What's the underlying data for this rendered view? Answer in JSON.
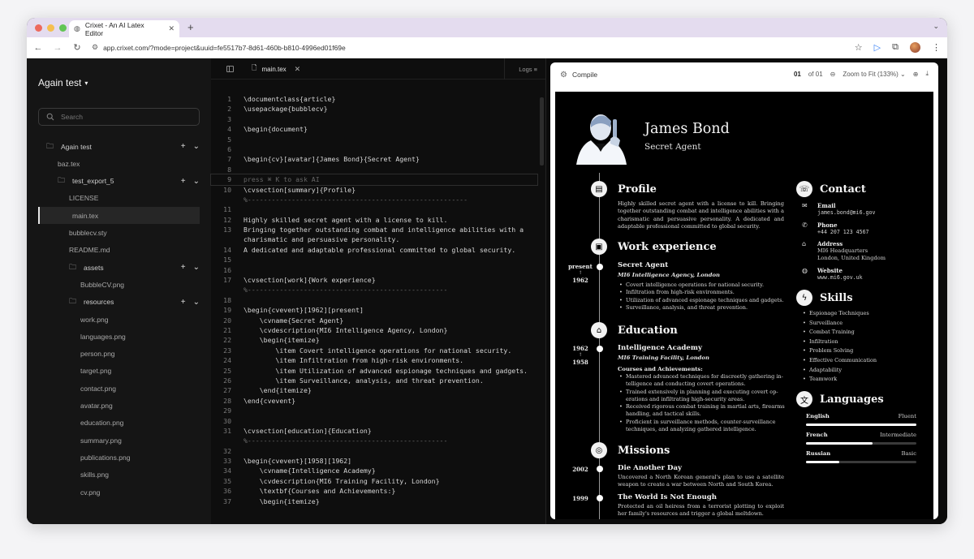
{
  "browser": {
    "tab_title": "Crixet - An AI Latex Editor",
    "url": "app.crixet.com/?mode=project&uuid=fe5517b7-8d61-460b-b810-4996ed01f69e",
    "traffic_colors": [
      "#ed6a5e",
      "#f5bf4f",
      "#61c554"
    ]
  },
  "sidebar": {
    "project_title": "Again test",
    "search_placeholder": "Search",
    "tree": [
      {
        "label": "Again test",
        "kind": "folder",
        "indent": 0,
        "actions": true
      },
      {
        "label": "baz.tex",
        "kind": "file",
        "indent": 1
      },
      {
        "label": "test_export_5",
        "kind": "folder",
        "indent": 1,
        "actions": true
      },
      {
        "label": "LICENSE",
        "kind": "file",
        "indent": 2
      },
      {
        "label": "main.tex",
        "kind": "file",
        "indent": 2,
        "active": true
      },
      {
        "label": "bubblecv.sty",
        "kind": "file",
        "indent": 2
      },
      {
        "label": "README.md",
        "kind": "file",
        "indent": 2
      },
      {
        "label": "assets",
        "kind": "folder",
        "indent": 2,
        "actions": true
      },
      {
        "label": "BubbleCV.png",
        "kind": "file",
        "indent": 3
      },
      {
        "label": "resources",
        "kind": "folder",
        "indent": 2,
        "actions": true
      },
      {
        "label": "work.png",
        "kind": "file",
        "indent": 3
      },
      {
        "label": "languages.png",
        "kind": "file",
        "indent": 3
      },
      {
        "label": "person.png",
        "kind": "file",
        "indent": 3
      },
      {
        "label": "target.png",
        "kind": "file",
        "indent": 3
      },
      {
        "label": "contact.png",
        "kind": "file",
        "indent": 3
      },
      {
        "label": "avatar.png",
        "kind": "file",
        "indent": 3
      },
      {
        "label": "education.png",
        "kind": "file",
        "indent": 3
      },
      {
        "label": "summary.png",
        "kind": "file",
        "indent": 3
      },
      {
        "label": "publications.png",
        "kind": "file",
        "indent": 3
      },
      {
        "label": "skills.png",
        "kind": "file",
        "indent": 3
      },
      {
        "label": "cv.png",
        "kind": "file",
        "indent": 3
      }
    ]
  },
  "editor": {
    "tab_label": "main.tex",
    "logs_label": "Logs",
    "lines": [
      {
        "n": "1",
        "t": "\\documentclass{article}"
      },
      {
        "n": "2",
        "t": "\\usepackage{bubblecv}"
      },
      {
        "n": "3",
        "t": ""
      },
      {
        "n": "4",
        "t": "\\begin{document}"
      },
      {
        "n": "5",
        "t": ""
      },
      {
        "n": "6",
        "t": ""
      },
      {
        "n": "7",
        "t": "\\begin{cv}[avatar]{James Bond}{Secret Agent}"
      },
      {
        "n": "8",
        "t": ""
      },
      {
        "n": "9",
        "t": "press ⌘ K to ask AI",
        "cur": true
      },
      {
        "n": "10",
        "t": "\\cvsection[summary]{Profile}"
      },
      {
        "n": "",
        "t": "%-------------------------------------------------------",
        "c": true
      },
      {
        "n": "11",
        "t": ""
      },
      {
        "n": "12",
        "t": "Highly skilled secret agent with a license to kill."
      },
      {
        "n": "13",
        "t": "Bringing together outstanding combat and intelligence abilities with a"
      },
      {
        "n": "",
        "t": "charismatic and persuasive personality."
      },
      {
        "n": "14",
        "t": "A dedicated and adaptable professional committed to global security."
      },
      {
        "n": "15",
        "t": ""
      },
      {
        "n": "16",
        "t": ""
      },
      {
        "n": "17",
        "t": "\\cvsection[work]{Work experience}"
      },
      {
        "n": "",
        "t": "%--------------------------------------------------",
        "c": true
      },
      {
        "n": "18",
        "t": ""
      },
      {
        "n": "19",
        "t": "\\begin{cvevent}[1962][present]"
      },
      {
        "n": "20",
        "t": "    \\cvname{Secret Agent}"
      },
      {
        "n": "21",
        "t": "    \\cvdescription{MI6 Intelligence Agency, London}"
      },
      {
        "n": "22",
        "t": "    \\begin{itemize}"
      },
      {
        "n": "23",
        "t": "        \\item Covert intelligence operations for national security."
      },
      {
        "n": "24",
        "t": "        \\item Infiltration from high-risk environments."
      },
      {
        "n": "25",
        "t": "        \\item Utilization of advanced espionage techniques and gadgets."
      },
      {
        "n": "26",
        "t": "        \\item Surveillance, analysis, and threat prevention."
      },
      {
        "n": "27",
        "t": "    \\end{itemize}"
      },
      {
        "n": "28",
        "t": "\\end{cvevent}"
      },
      {
        "n": "29",
        "t": ""
      },
      {
        "n": "30",
        "t": ""
      },
      {
        "n": "31",
        "t": "\\cvsection[education]{Education}"
      },
      {
        "n": "",
        "t": "%--------------------------------------------------",
        "c": true
      },
      {
        "n": "32",
        "t": ""
      },
      {
        "n": "33",
        "t": "\\begin{cvevent}[1958][1962]"
      },
      {
        "n": "34",
        "t": "    \\cvname{Intelligence Academy}"
      },
      {
        "n": "35",
        "t": "    \\cvdescription{MI6 Training Facility, London}"
      },
      {
        "n": "36",
        "t": "    \\textbf{Courses and Achievements:}"
      },
      {
        "n": "37",
        "t": "    \\begin{itemize}"
      }
    ]
  },
  "preview": {
    "compile_label": "Compile",
    "page_current": "01",
    "page_total": "of 01",
    "zoom": "Zoom to Fit (133%)",
    "cv": {
      "name": "James Bond",
      "role": "Secret Agent",
      "profile": {
        "title": "Profile",
        "text": "Highly skilled secret agent with a license to kill. Bringing together outstanding combat and intelligence abilities with a charismatic and persuasive personality. A dedicated and adaptable professional committed to global security."
      },
      "work": {
        "title": "Work experience",
        "date_to": "present",
        "date_from": "1962",
        "name": "Secret Agent",
        "org": "MI6 Intelligence Agency, London",
        "items": [
          "Covert intelligence operations for national security.",
          "Infiltration from high-risk environments.",
          "Utilization of advanced espionage techniques and gadgets.",
          "Surveillance, analysis, and threat prevention."
        ]
      },
      "education": {
        "title": "Education",
        "date_to": "1962",
        "date_from": "1958",
        "name": "Intelligence Academy",
        "org": "MI6 Training Facility, London",
        "sub": "Courses and Achievements:",
        "items": [
          "Mastered advanced techniques for discreetly gathering in-telligence and conducting covert operations.",
          "Trained extensively in planning and executing covert op-erations and infiltrating high-security areas.",
          "Received rigorous combat training in martial arts, firearms handling, and tactical skills.",
          "Proficient in surveillance methods, counter-surveillance techniques, and analyzing gathered intelligence."
        ]
      },
      "missions": {
        "title": "Missions",
        "m1_year": "2002",
        "m1_name": "Die Another Day",
        "m1_text": "Uncovered a North Korean general's plan to use a satellite weapon to create a war between North and South Korea.",
        "m2_year": "1999",
        "m2_name": "The World Is Not Enough",
        "m2_text": "Protected an oil heiress from a terrorist plotting to exploit her family's resources and trigger a global meltdown."
      },
      "contact": {
        "title": "Contact",
        "email_label": "Email",
        "email": "james.bond@mi6.gov",
        "phone_label": "Phone",
        "phone": "+44 207 123 4567",
        "address_label": "Address",
        "address1": "MI6 Headquarters",
        "address2": "London, United Kingdom",
        "website_label": "Website",
        "website": "www.mi6.gov.uk"
      },
      "skills": {
        "title": "Skills",
        "items": [
          "Espionage Techniques",
          "Surveillance",
          "Combat Training",
          "Infiltration",
          "Problem Solving",
          "Effective Communication",
          "Adaptability",
          "Teamwork"
        ]
      },
      "languages": {
        "title": "Languages",
        "items": [
          {
            "name": "English",
            "level": "Fluent",
            "fill": 1.0
          },
          {
            "name": "French",
            "level": "Intermediate",
            "fill": 0.6
          },
          {
            "name": "Russian",
            "level": "Basic",
            "fill": 0.3
          }
        ]
      }
    }
  }
}
